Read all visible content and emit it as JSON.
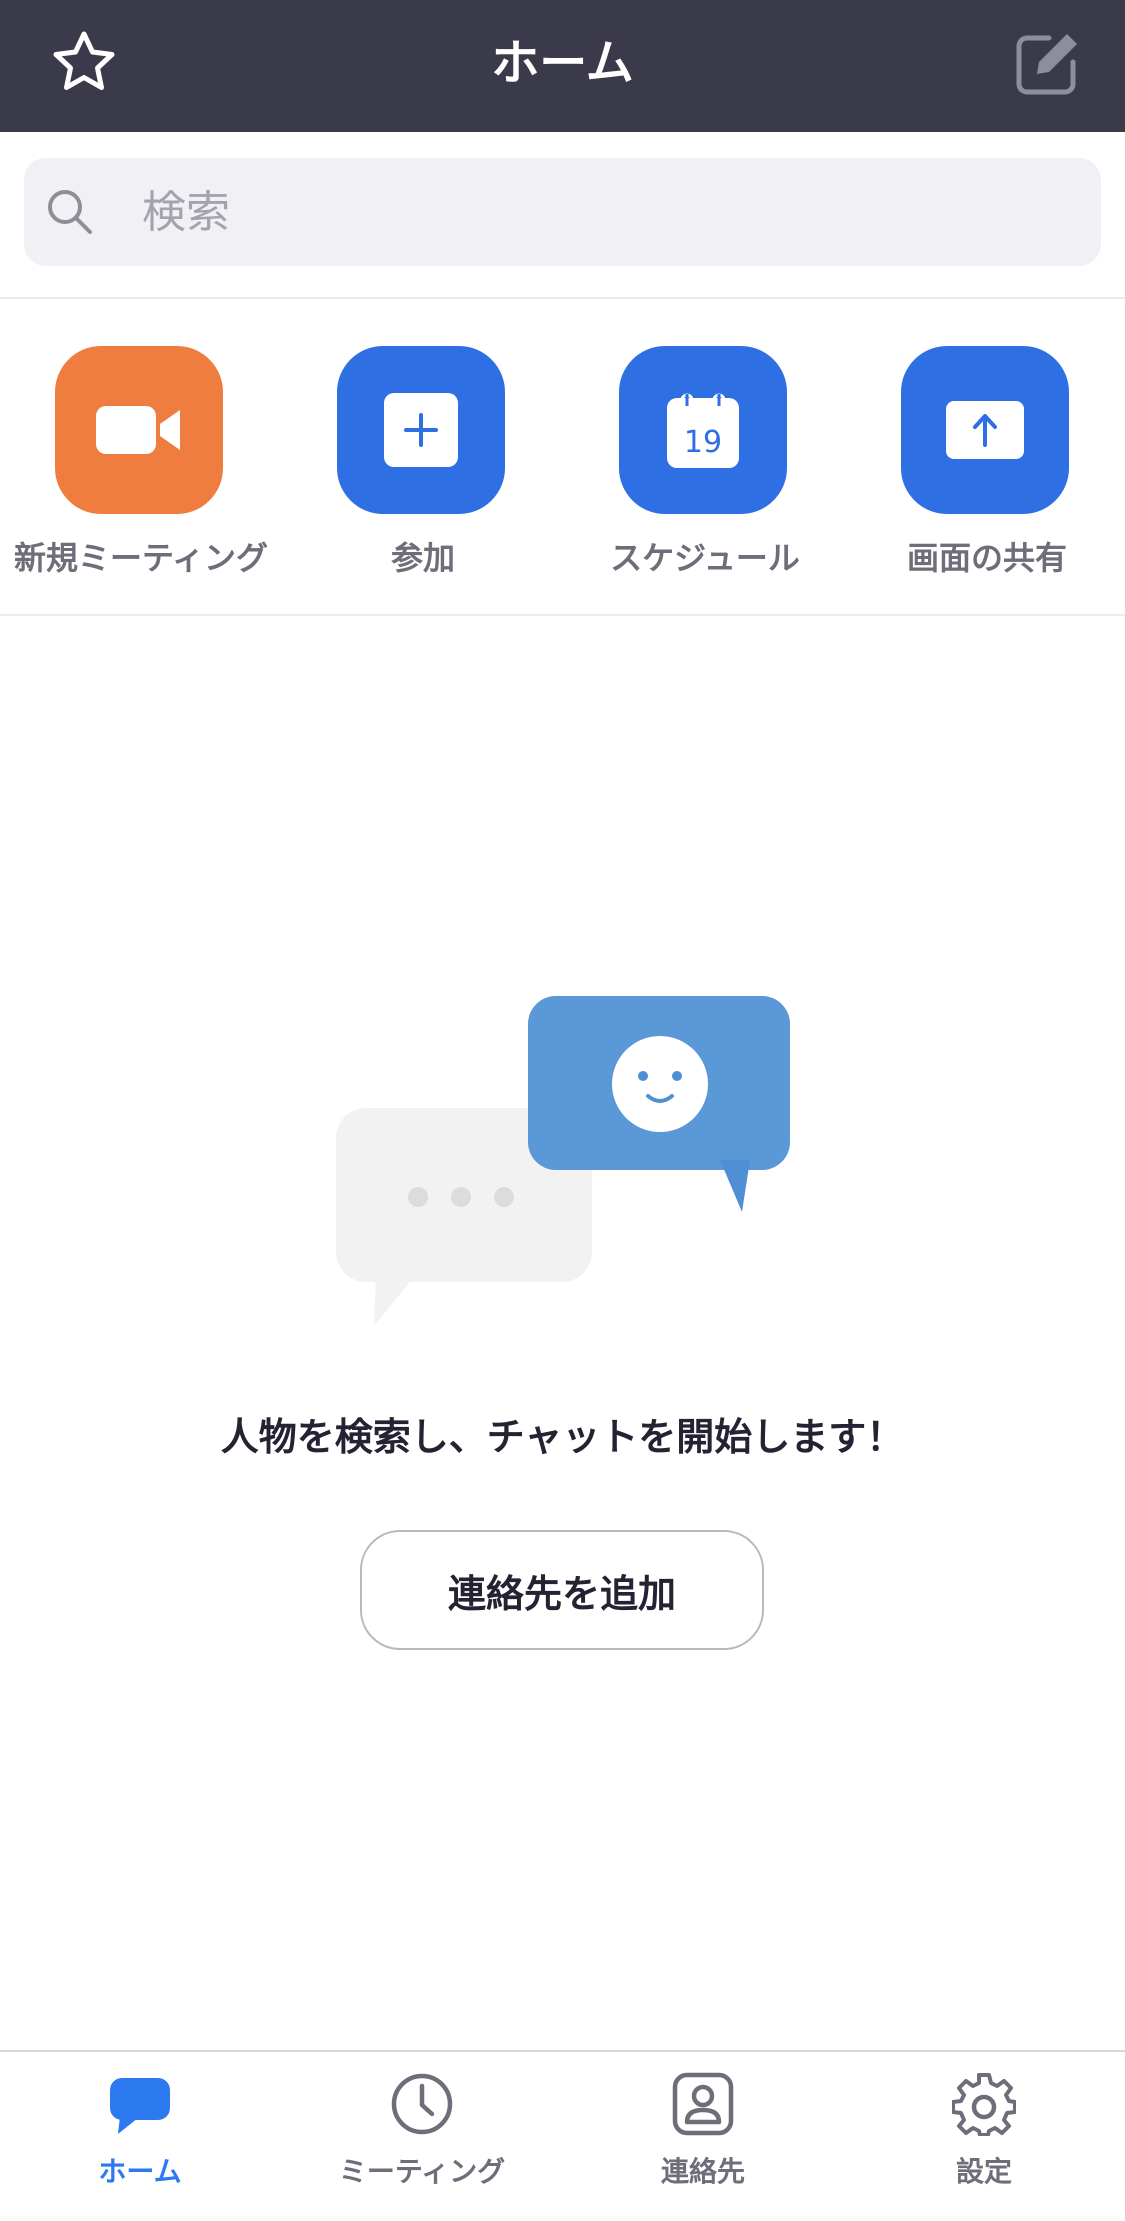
{
  "header": {
    "title": "ホーム",
    "left_icon": "star-icon",
    "right_icon": "edit-icon"
  },
  "search": {
    "placeholder": "検索",
    "value": ""
  },
  "actions": [
    {
      "label": "新規ミーティング",
      "icon": "video-camera-icon",
      "color": "#ee7d3f"
    },
    {
      "label": "参加",
      "icon": "plus-icon",
      "color": "#2f6fe4"
    },
    {
      "label": "スケジュール",
      "icon": "calendar-icon",
      "color": "#2f6fe4",
      "day": "19"
    },
    {
      "label": "画面の共有",
      "icon": "share-screen-icon",
      "color": "#2f6fe4"
    }
  ],
  "empty_state": {
    "message": "人物を検索し、チャットを開始します！",
    "button_label": "連絡先を追加"
  },
  "tabbar": {
    "active_color": "#2d7af0",
    "tabs": [
      {
        "label": "ホーム",
        "icon": "chat-bubble-icon",
        "active": true
      },
      {
        "label": "ミーティング",
        "icon": "clock-icon",
        "active": false
      },
      {
        "label": "連絡先",
        "icon": "contact-card-icon",
        "active": false
      },
      {
        "label": "設定",
        "icon": "gear-icon",
        "active": false
      }
    ]
  }
}
